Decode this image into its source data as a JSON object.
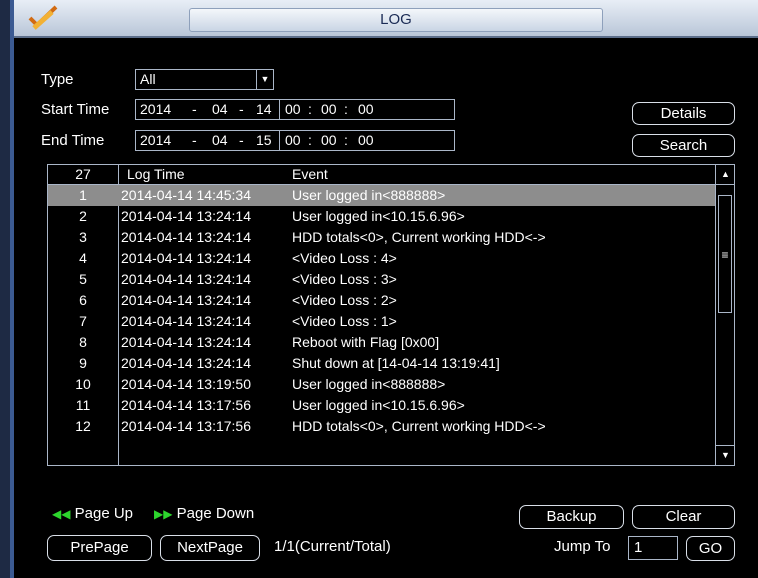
{
  "window": {
    "title": "LOG"
  },
  "filters": {
    "type_label": "Type",
    "type_value": "All",
    "start_label": "Start Time",
    "start": {
      "year": "2014",
      "sep1": "-",
      "month": "04",
      "sep2": "-",
      "day": "14",
      "hh": "00",
      "c1": ":",
      "mm": "00",
      "c2": ":",
      "ss": "00"
    },
    "end_label": "End Time",
    "end": {
      "year": "2014",
      "sep1": "-",
      "month": "04",
      "sep2": "-",
      "day": "15",
      "hh": "00",
      "c1": ":",
      "mm": "00",
      "c2": ":",
      "ss": "00"
    }
  },
  "buttons": {
    "details": "Details",
    "search": "Search",
    "backup": "Backup",
    "clear": "Clear",
    "prepage": "PrePage",
    "nextpage": "NextPage",
    "go": "GO"
  },
  "table": {
    "count": "27",
    "col_time": "Log Time",
    "col_event": "Event",
    "selected_row": 0,
    "rows": [
      {
        "n": "1",
        "time": "2014-04-14 14:45:34",
        "event": "User logged in<888888>"
      },
      {
        "n": "2",
        "time": "2014-04-14 13:24:14",
        "event": "User logged in<10.15.6.96>"
      },
      {
        "n": "3",
        "time": "2014-04-14 13:24:14",
        "event": "HDD totals<0>, Current working HDD<->"
      },
      {
        "n": "4",
        "time": "2014-04-14 13:24:14",
        "event": "<Video Loss : 4>"
      },
      {
        "n": "5",
        "time": "2014-04-14 13:24:14",
        "event": "<Video Loss : 3>"
      },
      {
        "n": "6",
        "time": "2014-04-14 13:24:14",
        "event": "<Video Loss : 2>"
      },
      {
        "n": "7",
        "time": "2014-04-14 13:24:14",
        "event": "<Video Loss : 1>"
      },
      {
        "n": "8",
        "time": "2014-04-14 13:24:14",
        "event": "Reboot with Flag [0x00]"
      },
      {
        "n": "9",
        "time": "2014-04-14 13:24:14",
        "event": "Shut down at [14-04-14 13:19:41]"
      },
      {
        "n": "10",
        "time": "2014-04-14 13:19:50",
        "event": "User logged in<888888>"
      },
      {
        "n": "11",
        "time": "2014-04-14 13:17:56",
        "event": "User logged in<10.15.6.96>"
      },
      {
        "n": "12",
        "time": "2014-04-14 13:17:56",
        "event": "HDD totals<0>, Current working HDD<->"
      }
    ]
  },
  "pager": {
    "page_up": "Page Up",
    "page_down": "Page Down",
    "status": "1/1(Current/Total)",
    "jump_label": "Jump To",
    "jump_value": "1"
  },
  "colors": {
    "selected_row": "#8d8d8d",
    "page_icon": "#2dd62d",
    "title_text": "#1b2b55"
  },
  "icons": {
    "logo": "pen-check-logo",
    "page_up": "skip-back-icon",
    "page_down": "skip-forward-icon"
  }
}
